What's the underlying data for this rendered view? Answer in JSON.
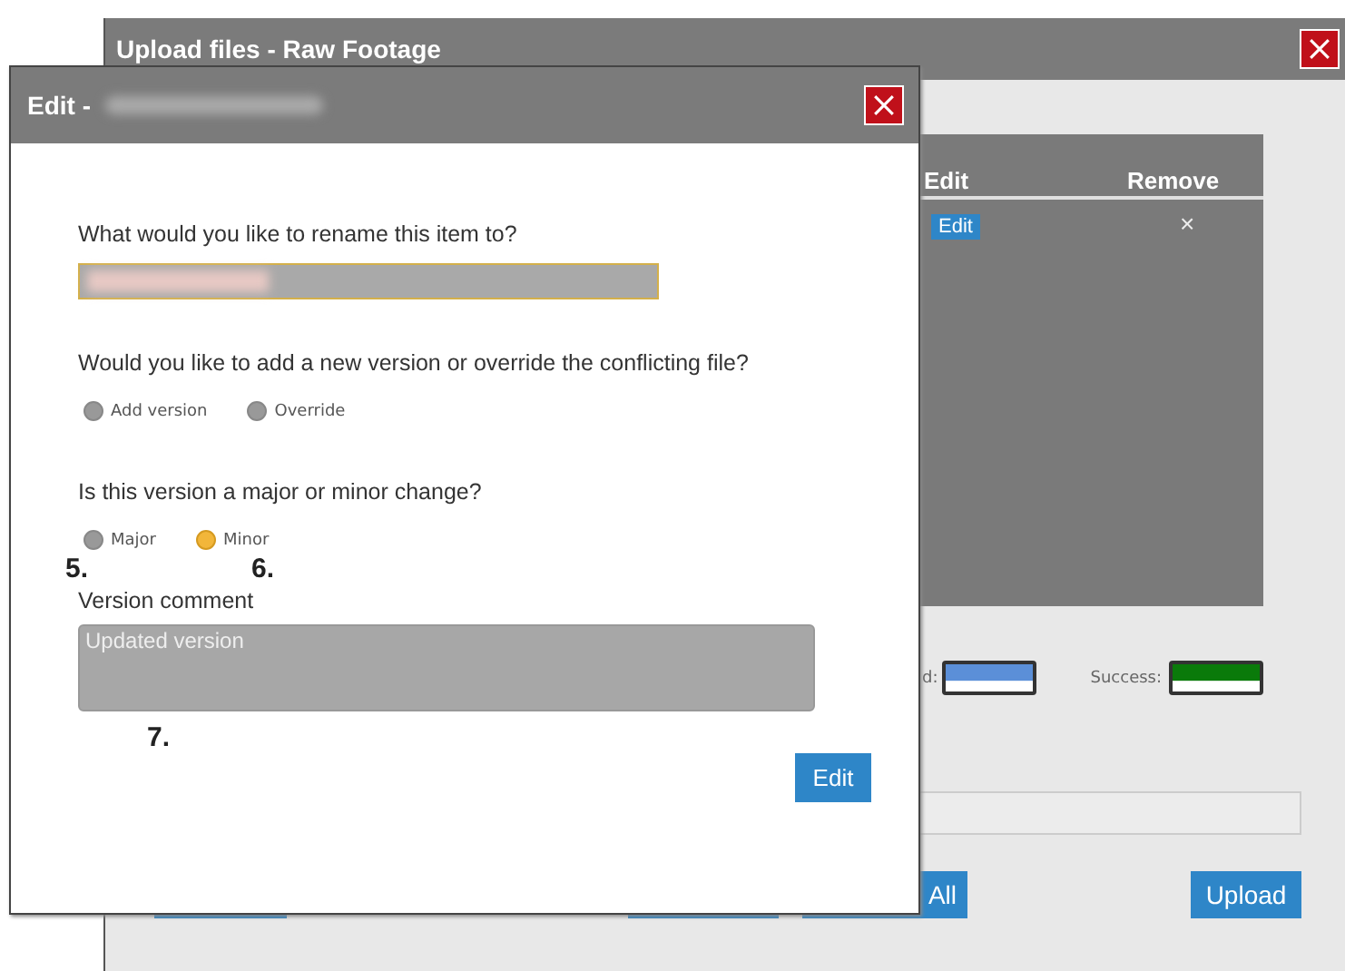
{
  "upload_window": {
    "title": "Upload files - Raw Footage",
    "table": {
      "columns": [
        "Edit",
        "Remove"
      ],
      "rows": [
        {
          "edit": "Edit",
          "remove": "×"
        }
      ]
    },
    "legend": [
      {
        "label": "d:",
        "color": "#5b8fd8"
      },
      {
        "label": "Success:",
        "color": "#0a7a0a"
      }
    ],
    "buttons": [
      {
        "kind": "blank"
      },
      {
        "kind": "blank"
      },
      {
        "kind": "text",
        "label": "All"
      },
      {
        "kind": "text",
        "label": "Upload"
      }
    ]
  },
  "edit_dialog": {
    "title": "Edit -",
    "title_redacted": true,
    "rename": {
      "question": "What would you like to rename this item to?",
      "redacted": true
    },
    "groups": [
      {
        "question": "Would you like to add a new version or override the conflicting file?",
        "options": [
          {
            "label": "Add version",
            "selected": false
          },
          {
            "label": "Override",
            "selected": false
          }
        ]
      },
      {
        "question": "Is this version a major or minor change?",
        "options": [
          {
            "label": "Major",
            "selected": false
          },
          {
            "label": "Minor",
            "selected": true
          }
        ],
        "annotations": [
          "5.",
          "6."
        ]
      }
    ],
    "comment": {
      "label": "Version comment",
      "value": "Updated version",
      "annotation": "7."
    },
    "button": "Edit"
  }
}
